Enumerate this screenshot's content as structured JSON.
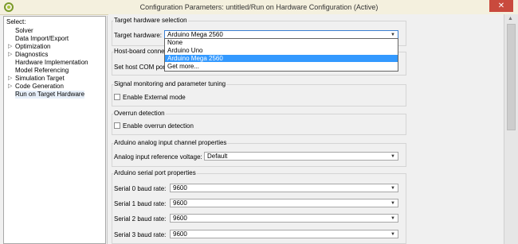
{
  "window": {
    "title": "Configuration Parameters: untitled/Run on Hardware Configuration (Active)",
    "close_glyph": "✕"
  },
  "tree": {
    "header": "Select:",
    "items": [
      {
        "label": "Solver",
        "expandable": false,
        "selected": false
      },
      {
        "label": "Data Import/Export",
        "expandable": false,
        "selected": false
      },
      {
        "label": "Optimization",
        "expandable": true,
        "selected": false
      },
      {
        "label": "Diagnostics",
        "expandable": true,
        "selected": false
      },
      {
        "label": "Hardware Implementation",
        "expandable": false,
        "selected": false
      },
      {
        "label": "Model Referencing",
        "expandable": false,
        "selected": false
      },
      {
        "label": "Simulation Target",
        "expandable": true,
        "selected": false
      },
      {
        "label": "Code Generation",
        "expandable": true,
        "selected": false
      },
      {
        "label": "Run on Target Hardware",
        "expandable": false,
        "selected": true
      }
    ],
    "arrow_glyph": "▷"
  },
  "target_hw": {
    "group_title": "Target hardware selection",
    "label": "Target hardware:",
    "value": "Arduino Mega 2560",
    "options": [
      "None",
      "Arduino Uno",
      "Arduino Mega 2560",
      "Get more..."
    ],
    "selected_index": 2
  },
  "host_board": {
    "group_title": "Host-board connec",
    "com_label": "Set host COM port"
  },
  "signal": {
    "group_title": "Signal monitoring and parameter tuning",
    "checkbox_label": "Enable External mode",
    "checked": false
  },
  "overrun": {
    "group_title": "Overrun detection",
    "checkbox_label": "Enable overrun detection",
    "checked": false
  },
  "analog": {
    "group_title": "Arduino analog input channel properties",
    "label": "Analog input reference voltage:",
    "value": "Default"
  },
  "serial": {
    "group_title": "Arduino serial port properties",
    "ports": [
      {
        "label": "Serial 0 baud rate:",
        "value": "9600"
      },
      {
        "label": "Serial 1 baud rate:",
        "value": "9600"
      },
      {
        "label": "Serial 2 baud rate:",
        "value": "9600"
      },
      {
        "label": "Serial 3 baud rate:",
        "value": "9600"
      }
    ]
  },
  "glyphs": {
    "combo_arrow": "▼",
    "scroll_up": "▲"
  },
  "colors": {
    "titlebar": "#f4f0de",
    "close": "#c94a3d",
    "selection": "#3399ff"
  }
}
